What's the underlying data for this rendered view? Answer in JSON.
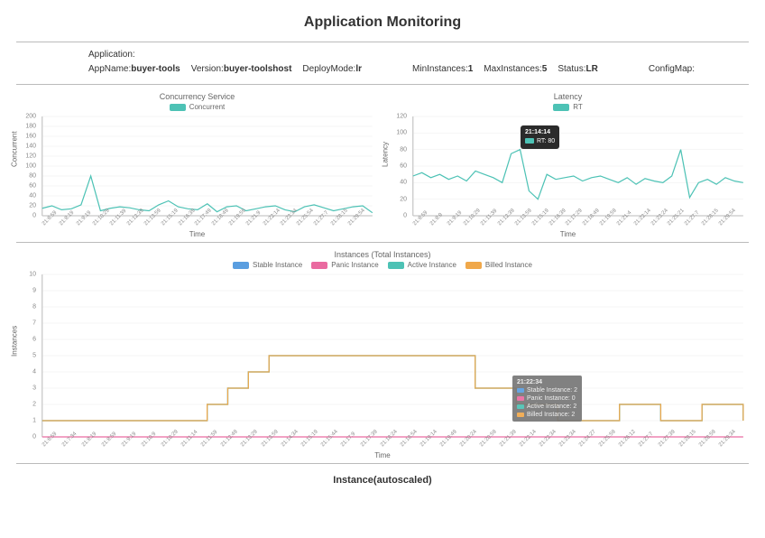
{
  "title": "Application Monitoring",
  "app_header": {
    "label_application": "Application:",
    "label_appname": "AppName:",
    "appname": "buyer-tools",
    "label_version": "Version:",
    "version": "buyer-toolshost",
    "label_deploymode": "DeployMode:",
    "deploymode": "lr",
    "label_mininst": "MinInstances:",
    "mininst": "1",
    "label_maxinst": "MaxInstances:",
    "maxinst": "5",
    "label_status": "Status:",
    "status": "LR",
    "label_configmap": "ConfigMap:"
  },
  "chart_data": [
    {
      "id": "concurrency",
      "type": "line",
      "title": "Concurrency Service",
      "xlabel": "Time",
      "ylabel": "Concurrent",
      "ylim": [
        0,
        200
      ],
      "yticks": [
        0,
        20,
        40,
        60,
        80,
        100,
        120,
        140,
        160,
        180,
        200
      ],
      "legend": [
        {
          "name": "Concurrent",
          "color": "#4dc2b5"
        }
      ],
      "categories": [
        "21:6:59",
        "21:8:19",
        "21:9:19",
        "21:10:29",
        "21:11:39",
        "21:12:39",
        "21:13:59",
        "21:15:19",
        "21:16:39",
        "21:17:49",
        "21:18:49",
        "21:19:59",
        "21:21:9",
        "21:22:14",
        "21:23:34",
        "21:25:54",
        "21:27:7",
        "21:28:15",
        "21:29:54"
      ],
      "series": [
        {
          "name": "Concurrent",
          "color": "#4dc2b5",
          "values": [
            15,
            20,
            12,
            14,
            22,
            80,
            10,
            15,
            18,
            16,
            12,
            10,
            22,
            30,
            18,
            14,
            12,
            24,
            8,
            18,
            20,
            10,
            14,
            18,
            20,
            12,
            8,
            18,
            22,
            16,
            10,
            14,
            18,
            20,
            6
          ]
        }
      ]
    },
    {
      "id": "latency",
      "type": "line",
      "title": "Latency",
      "xlabel": "Time",
      "ylabel": "Latency",
      "ylim": [
        0,
        120
      ],
      "yticks": [
        0,
        20,
        40,
        60,
        80,
        100,
        120
      ],
      "legend": [
        {
          "name": "RT",
          "color": "#4dc2b5"
        }
      ],
      "categories": [
        "21:6:59",
        "21:8:9",
        "21:9:19",
        "21:10:29",
        "21:11:39",
        "21:12:39",
        "21:13:59",
        "21:15:19",
        "21:16:39",
        "21:17:29",
        "21:18:49",
        "21:19:59",
        "21:21:4",
        "21:22:14",
        "21:23:24",
        "21:25:21",
        "21:27:7",
        "21:28:15",
        "21:29:54"
      ],
      "series": [
        {
          "name": "RT",
          "color": "#4dc2b5",
          "values": [
            48,
            52,
            46,
            50,
            44,
            48,
            42,
            54,
            50,
            46,
            40,
            75,
            80,
            30,
            20,
            50,
            44,
            46,
            48,
            42,
            46,
            48,
            44,
            40,
            46,
            38,
            45,
            42,
            40,
            48,
            80,
            22,
            40,
            44,
            38,
            46,
            42,
            40
          ]
        }
      ],
      "tooltip": {
        "time": "21:14:14",
        "items": [
          {
            "color": "#4dc2b5",
            "label": "RT: 80"
          }
        ]
      }
    },
    {
      "id": "instances",
      "type": "line",
      "title": "Instances (Total Instances)",
      "xlabel": "Time",
      "ylabel": "Instances",
      "ylim": [
        0,
        10
      ],
      "yticks": [
        0,
        1,
        2,
        3,
        4,
        5,
        6,
        7,
        8,
        9,
        10
      ],
      "legend": [
        {
          "name": "Stable Instance",
          "color": "#5a9ee0"
        },
        {
          "name": "Panic Instance",
          "color": "#ea6aa0"
        },
        {
          "name": "Active Instance",
          "color": "#4dc2b5"
        },
        {
          "name": "Billed Instance",
          "color": "#f0a84a"
        }
      ],
      "categories": [
        "21:6:59",
        "21:7:34",
        "21:8:19",
        "21:8:59",
        "21:9:19",
        "21:10:9",
        "21:10:29",
        "21:11:14",
        "21:11:59",
        "21:12:49",
        "21:13:29",
        "21:13:59",
        "21:14:34",
        "21:15:19",
        "21:15:44",
        "21:17:9",
        "21:17:39",
        "21:18:24",
        "21:18:54",
        "21:19:14",
        "21:19:49",
        "21:20:24",
        "21:20:59",
        "21:21:39",
        "21:22:14",
        "21:22:34",
        "21:23:34",
        "21:24:27",
        "21:25:59",
        "21:26:12",
        "21:27:7",
        "21:27:39",
        "21:28:15",
        "21:28:59",
        "21:29:34"
      ],
      "series": [
        {
          "name": "Stable Instance",
          "color": "#5a9ee0",
          "step": true,
          "values": [
            1,
            1,
            1,
            1,
            1,
            1,
            1,
            1,
            2,
            3,
            4,
            5,
            5,
            5,
            5,
            5,
            5,
            5,
            5,
            5,
            5,
            3,
            3,
            2,
            2,
            1,
            1,
            1,
            2,
            2,
            1,
            1,
            2,
            2,
            1
          ]
        },
        {
          "name": "Panic Instance",
          "color": "#ea6aa0",
          "step": true,
          "values": [
            0,
            0,
            0,
            0,
            0,
            0,
            0,
            0,
            0,
            0,
            0,
            0,
            0,
            0,
            0,
            0,
            0,
            0,
            0,
            0,
            0,
            0,
            0,
            0,
            0,
            0,
            0,
            0,
            0,
            0,
            0,
            0,
            0,
            0,
            0
          ]
        },
        {
          "name": "Active Instance",
          "color": "#4dc2b5",
          "step": true,
          "values": [
            1,
            1,
            1,
            1,
            1,
            1,
            1,
            1,
            2,
            3,
            4,
            5,
            5,
            5,
            5,
            5,
            5,
            5,
            5,
            5,
            5,
            3,
            3,
            2,
            2,
            1,
            1,
            1,
            2,
            2,
            1,
            1,
            2,
            2,
            1
          ]
        },
        {
          "name": "Billed Instance",
          "color": "#f0a84a",
          "step": true,
          "values": [
            1,
            1,
            1,
            1,
            1,
            1,
            1,
            1,
            2,
            3,
            4,
            5,
            5,
            5,
            5,
            5,
            5,
            5,
            5,
            5,
            5,
            3,
            3,
            2,
            2,
            1,
            1,
            1,
            2,
            2,
            1,
            1,
            2,
            2,
            1
          ]
        }
      ],
      "tooltip": {
        "time": "21:22:34",
        "items": [
          {
            "color": "#5a9ee0",
            "label": "Stable Instance: 2"
          },
          {
            "color": "#ea6aa0",
            "label": "Panic Instance: 0"
          },
          {
            "color": "#4dc2b5",
            "label": "Active Instance: 2"
          },
          {
            "color": "#f0a84a",
            "label": "Billed Instance: 2"
          }
        ]
      }
    }
  ],
  "footer_title": "Instance(autoscaled)"
}
